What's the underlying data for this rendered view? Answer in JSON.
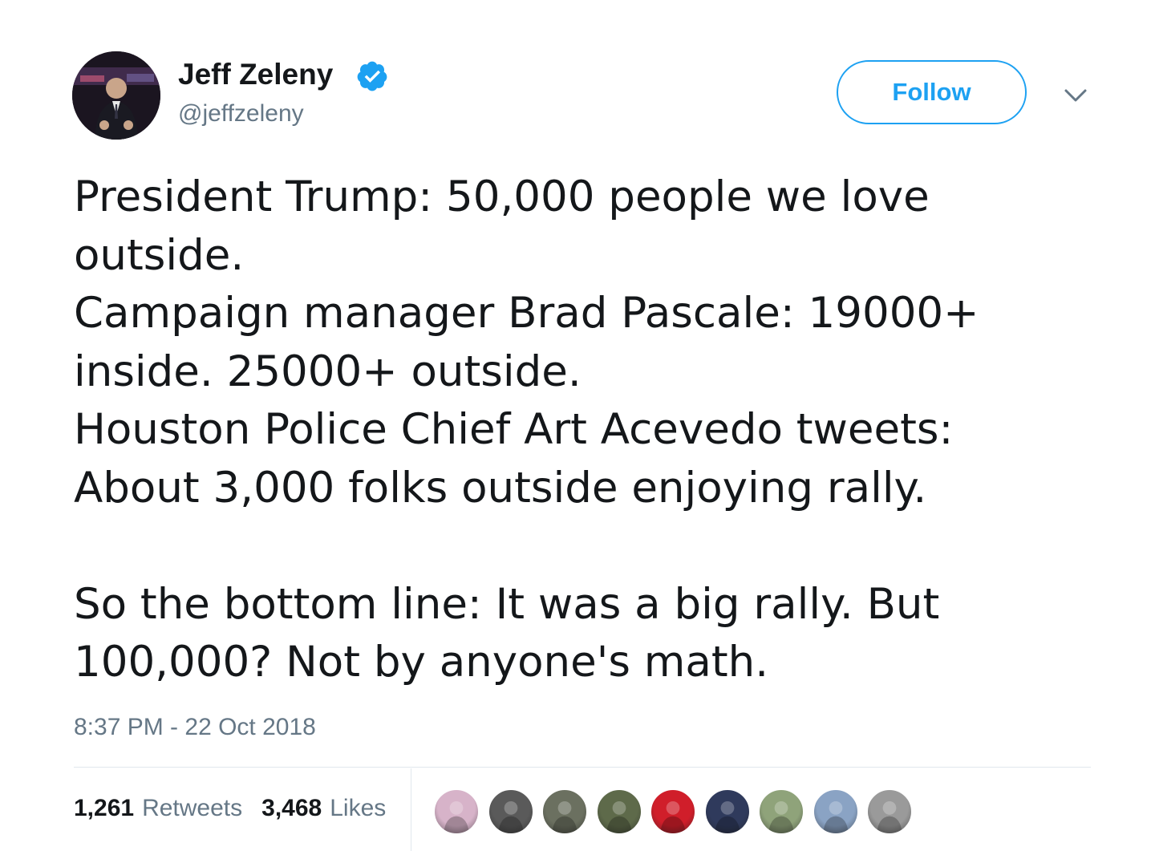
{
  "user": {
    "display_name": "Jeff Zeleny",
    "handle": "@jeffzeleny",
    "avatar_icon": "avatar-photo",
    "verified_icon": "verified-badge-icon"
  },
  "actions": {
    "follow_label": "Follow",
    "menu_icon": "chevron-down-icon"
  },
  "tweet": {
    "text": "President Trump: 50,000 people we love\noutside.\nCampaign manager Brad Pascale: 19000+\ninside. 25000+ outside.\nHouston Police Chief Art Acevedo tweets:\nAbout 3,000 folks outside enjoying rally.\n\nSo the bottom line: It was a big rally. But\n100,000? Not by anyone's math.",
    "timestamp": "8:37 PM - 22 Oct 2018"
  },
  "stats": {
    "retweets_count": "1,261",
    "retweets_label": "Retweets",
    "likes_count": "3,468",
    "likes_label": "Likes"
  },
  "likers": [
    {
      "name": "liker-avatar-1",
      "color": "#d7b3c9"
    },
    {
      "name": "liker-avatar-2",
      "color": "#5a5a5a"
    },
    {
      "name": "liker-avatar-3",
      "color": "#6b7060"
    },
    {
      "name": "liker-avatar-4",
      "color": "#5e6a4a"
    },
    {
      "name": "liker-avatar-5",
      "color": "#d01e2a"
    },
    {
      "name": "liker-avatar-6",
      "color": "#2f3a5c"
    },
    {
      "name": "liker-avatar-7",
      "color": "#8fa37a"
    },
    {
      "name": "liker-avatar-8",
      "color": "#8aa3c4"
    },
    {
      "name": "liker-avatar-9",
      "color": "#9a9a9a"
    }
  ],
  "colors": {
    "accent": "#1da1f2",
    "text_primary": "#14171a",
    "text_secondary": "#657786",
    "divider": "#e1e8ed"
  }
}
